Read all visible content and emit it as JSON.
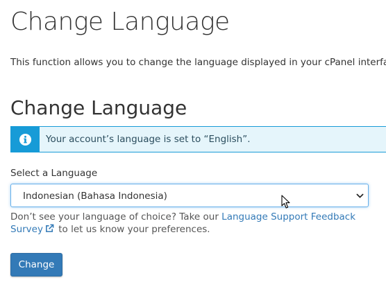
{
  "page": {
    "title": "Change Language",
    "description": "This function allows you to change the language displayed in your cPanel interface."
  },
  "section": {
    "title": "Change Language"
  },
  "alert": {
    "icon": "info-icon",
    "text": "Your account’s language is set to “English”.",
    "accent_color": "#179bd7",
    "background_color": "#e5f5fb"
  },
  "language_select": {
    "label": "Select a Language",
    "selected_value": "Indonesian (Bahasa Indonesia)"
  },
  "help": {
    "text_before": "Don’t see your language of choice? Take our ",
    "link_part1": "Language Support Feedback",
    "link_part2": "Survey",
    "link_icon": "external-link-icon",
    "text_after": " to let us know your preferences.",
    "link_color": "#337ab7"
  },
  "actions": {
    "change_label": "Change",
    "button_color": "#337ab7"
  }
}
